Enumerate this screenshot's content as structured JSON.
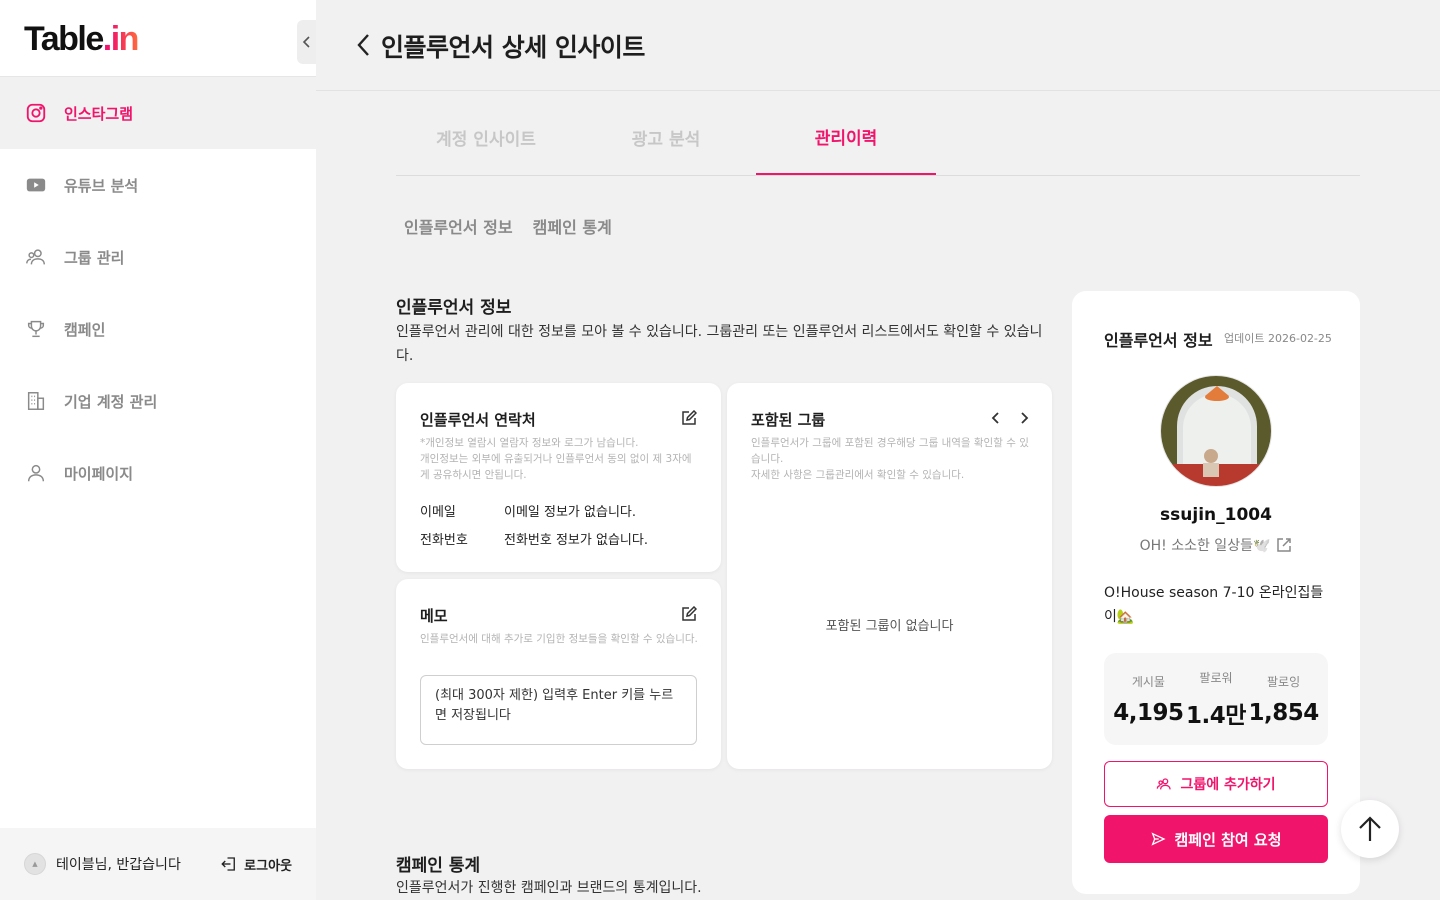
{
  "brand": {
    "logo_main": "Table",
    "logo_dot": ".",
    "logo_suffix": "in",
    "accent": "#f0146b"
  },
  "sidebar": {
    "items": [
      {
        "label": "인스타그램",
        "icon": "instagram-icon",
        "active": true
      },
      {
        "label": "유튜브 분석",
        "icon": "youtube-icon"
      },
      {
        "label": "그룹 관리",
        "icon": "users-icon"
      },
      {
        "label": "캠페인",
        "icon": "trophy-icon"
      },
      {
        "label": "기업 계정 관리",
        "icon": "building-icon"
      },
      {
        "label": "마이페이지",
        "icon": "user-icon"
      }
    ],
    "greeting": "테이블님, 반갑습니다",
    "logout_label": "로그아웃"
  },
  "header": {
    "title": "인플루언서 상세 인사이트"
  },
  "tabs": [
    {
      "label": "계정 인사이트"
    },
    {
      "label": "광고 분석"
    },
    {
      "label": "관리이력",
      "active": true
    }
  ],
  "subtabs": [
    {
      "label": "인플루언서 정보"
    },
    {
      "label": "캠페인 통계"
    }
  ],
  "section_info": {
    "title": "인플루언서 정보",
    "desc": "인플루언서 관리에 대한 정보를 모아 볼 수 있습니다. 그룹관리 또는 인플루언서 리스트에서도 확인할 수 있습니다."
  },
  "contact_card": {
    "title": "인플루언서 연락처",
    "note_1": "*개인정보 열람시 열람자 정보와 로그가 남습니다.",
    "note_2": "개인정보는 외부에 유출되거나 인플루언서 동의 없이 제 3자에게 공유하시면 안됩니다.",
    "email_label": "이메일",
    "email_value": "이메일 정보가 없습니다.",
    "phone_label": "전화번호",
    "phone_value": "전화번호 정보가 없습니다."
  },
  "memo_card": {
    "title": "메모",
    "note": "인플루언서에 대해 추가로 기입한 정보들을 확인할 수 있습니다.",
    "placeholder": "(최대 300자 제한) 입력후 Enter 키를 누르면 저장됩니다"
  },
  "groups_card": {
    "title": "포함된 그룹",
    "note_1": "인플루언서가 그룹에 포함된 경우해당 그룹 내역을 확인할 수 있습니다.",
    "note_2": "자세한 사항은 그룹관리에서 확인할 수 있습니다.",
    "empty": "포함된 그룹이 없습니다"
  },
  "profile_panel": {
    "title": "인플루언서 정보",
    "updated": "업데이트 2026-02-25",
    "username": "ssujin_1004",
    "bio_short": "OH! 소소한 일상들🕊️",
    "bio_long": "O!House season 7-10 온라인집들이🏡",
    "stats": [
      {
        "label": "게시물",
        "value": "4,195"
      },
      {
        "label": "팔로워",
        "value": "1.4만"
      },
      {
        "label": "팔로잉",
        "value": "1,854"
      }
    ],
    "add_group_label": "그룹에 추가하기",
    "campaign_label": "캠페인 참여 요청"
  },
  "section_campaign": {
    "title": "캠페인 통계",
    "desc": "인플루언서가 진행한 캠페인과 브랜드의 통계입니다."
  }
}
